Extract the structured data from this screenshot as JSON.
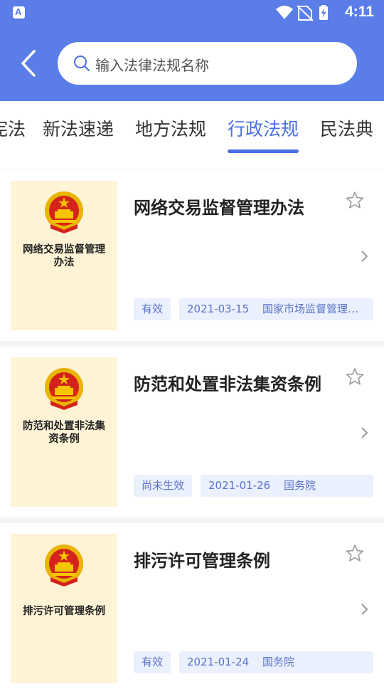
{
  "statusbar": {
    "time": "4:11"
  },
  "search": {
    "placeholder": "输入法律法规名称"
  },
  "tabs": [
    {
      "label": "宪法"
    },
    {
      "label": "新法速递"
    },
    {
      "label": "地方法规"
    },
    {
      "label": "行政法规"
    },
    {
      "label": "民法典"
    }
  ],
  "active_tab": "行政法规",
  "colors": {
    "header": "#5a7de8",
    "accent": "#4a6fe3",
    "cover": "#fff3d6",
    "tag_bg": "#eaf0fd",
    "tag_text": "#5a73c9"
  },
  "items": [
    {
      "title": "网络交易监督管理办法",
      "cover_title": "网络交易监督管理办法",
      "status": "有效",
      "date": "2021-03-15",
      "issuer": "国家市场监督管理总..."
    },
    {
      "title": "防范和处置非法集资条例",
      "cover_title": "防范和处置非法集资条例",
      "status": "尚未生效",
      "date": "2021-01-26",
      "issuer": "国务院"
    },
    {
      "title": "排污许可管理条例",
      "cover_title": "排污许可管理条例",
      "status": "有效",
      "date": "2021-01-24",
      "issuer": "国务院"
    }
  ]
}
